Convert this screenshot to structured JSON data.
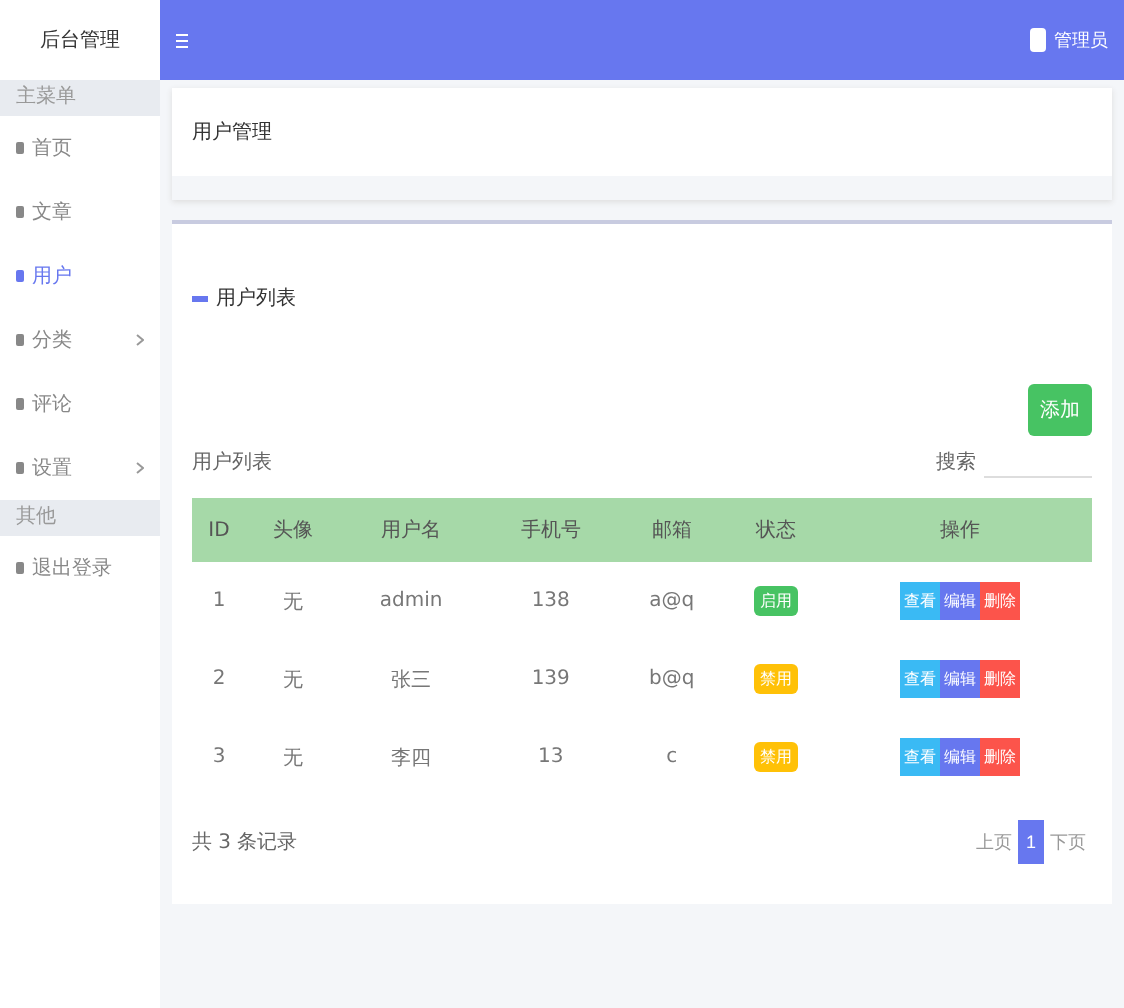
{
  "logo": "后台管理",
  "sidebar": {
    "groups": [
      {
        "title": "主菜单",
        "items": [
          {
            "label": "首页",
            "selected": false,
            "expandable": false
          },
          {
            "label": "文章",
            "selected": false,
            "expandable": false
          },
          {
            "label": "用户",
            "selected": true,
            "expandable": false
          },
          {
            "label": "分类",
            "selected": false,
            "expandable": true
          },
          {
            "label": "评论",
            "selected": false,
            "expandable": false
          },
          {
            "label": "设置",
            "selected": false,
            "expandable": true
          }
        ]
      },
      {
        "title": "其他",
        "items": [
          {
            "label": "退出登录",
            "selected": false,
            "expandable": false
          }
        ]
      }
    ]
  },
  "topbar": {
    "user": "管理员"
  },
  "page_title": "用户管理",
  "panel": {
    "title": "用户列表",
    "add_button": "添加",
    "toolbar_label": "用户列表",
    "search_label": "搜索",
    "columns": [
      "ID",
      "头像",
      "用户名",
      "手机号",
      "邮箱",
      "状态",
      "操作"
    ],
    "rows": [
      {
        "cells": [
          "1",
          "无",
          "admin",
          "138",
          "a@q"
        ],
        "status": "启用",
        "color": "#47c363",
        "actions": [
          "查看",
          "编辑",
          "删除"
        ]
      },
      {
        "cells": [
          "2",
          "无",
          "张三",
          "139",
          "b@q"
        ],
        "status": "禁用",
        "color": "#ffc107",
        "actions": [
          "查看",
          "编辑",
          "删除"
        ]
      },
      {
        "cells": [
          "3",
          "无",
          "李四",
          "13",
          "c"
        ],
        "status": "禁用",
        "color": "#ffc107",
        "actions": [
          "查看",
          "编辑",
          "删除"
        ]
      }
    ],
    "footer": "共 3 条记录",
    "pager": {
      "prev": "上页",
      "current": "1",
      "next": "下页"
    }
  }
}
